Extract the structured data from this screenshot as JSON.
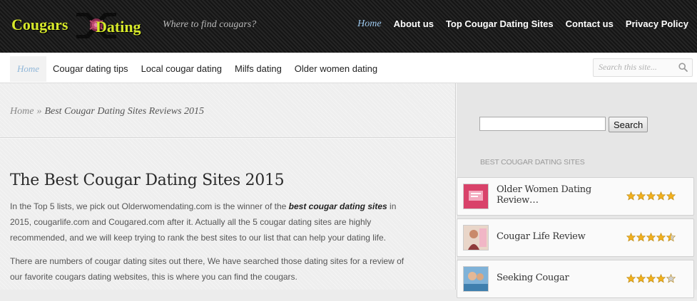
{
  "header": {
    "logo_word1": "Cougars",
    "logo_word2": "Dating",
    "tagline": "Where to find cougars?",
    "nav": [
      {
        "label": "Home",
        "active": true
      },
      {
        "label": "About us"
      },
      {
        "label": "Top Cougar Dating Sites"
      },
      {
        "label": "Contact us"
      },
      {
        "label": "Privacy Policy"
      }
    ]
  },
  "subnav": {
    "items": [
      {
        "label": "Home",
        "active": true
      },
      {
        "label": "Cougar dating tips"
      },
      {
        "label": "Local cougar dating"
      },
      {
        "label": "Milfs dating"
      },
      {
        "label": "Older women dating"
      }
    ],
    "search_placeholder": "Search this site..."
  },
  "breadcrumb": {
    "home": "Home",
    "separator": "»",
    "current": "Best Cougar Dating Sites Reviews 2015"
  },
  "article": {
    "title": "The Best Cougar Dating Sites 2015",
    "p1_before": "In the Top 5 lists, we pick out Olderwomendating.com is the winner of the ",
    "p1_bold": "best cougar dating sites",
    "p1_after": " in 2015, cougarlife.com and Cougared.com after it. Actually all the 5 cougar dating sites are highly recommended, and we will keep trying to rank the best sites to our list that can help your dating life.",
    "p2": "There are numbers of cougar dating sites out there, We have searched those dating sites for a review of our favorite cougars dating websites, this is where you can find the cougars."
  },
  "sidebar": {
    "search_button": "Search",
    "search_value": "",
    "widget_title": "BEST COUGAR DATING SITES",
    "sites": [
      {
        "name": "Older Women Dating Review…",
        "rating": 5,
        "thumb_color": "#d9426a"
      },
      {
        "name": "Cougar Life Review",
        "rating": 4.5,
        "thumb_color": "#c98a6a"
      },
      {
        "name": "Seeking Cougar",
        "rating": 4,
        "thumb_color": "#3f7fae"
      }
    ]
  },
  "colors": {
    "logo_yellow": "#d7e92a",
    "active_link": "#9cc7ec",
    "star_gold": "#f2b01e",
    "star_empty": "#cfcfcf"
  }
}
